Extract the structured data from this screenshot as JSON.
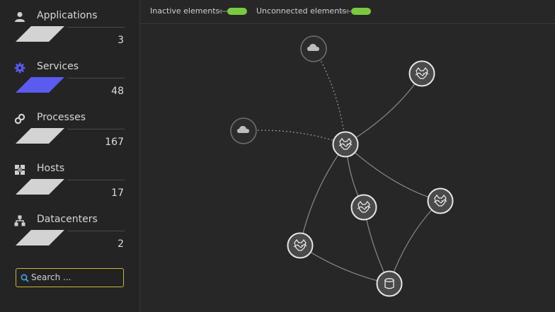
{
  "sidebar": {
    "layers": [
      {
        "label": "Applications",
        "count": "3",
        "icon": "user-icon",
        "active": false
      },
      {
        "label": "Services",
        "count": "48",
        "icon": "gear-icon",
        "active": true
      },
      {
        "label": "Processes",
        "count": "167",
        "icon": "link-icon",
        "active": false
      },
      {
        "label": "Hosts",
        "count": "17",
        "icon": "grid-icon",
        "active": false
      },
      {
        "label": "Datacenters",
        "count": "2",
        "icon": "hierarchy-icon",
        "active": false
      }
    ],
    "search": {
      "placeholder": "Search ..."
    }
  },
  "topbar": {
    "inactive_label": "Inactive elements:",
    "unconnected_label": "Unconnected elements:",
    "inactive_on": true,
    "unconnected_on": true
  },
  "graph": {
    "nodes": [
      {
        "id": "cloud-1",
        "type": "cloud",
        "inactive": true
      },
      {
        "id": "cloud-2",
        "type": "cloud",
        "inactive": true
      },
      {
        "id": "service-top-right",
        "type": "tomcat"
      },
      {
        "id": "service-center",
        "type": "tomcat"
      },
      {
        "id": "service-middle",
        "type": "tomcat"
      },
      {
        "id": "service-right",
        "type": "tomcat"
      },
      {
        "id": "service-bottom-left",
        "type": "tomcat"
      },
      {
        "id": "database",
        "type": "database"
      }
    ],
    "edges": [
      {
        "from": "cloud-1",
        "to": "service-center",
        "style": "dotted"
      },
      {
        "from": "cloud-2",
        "to": "service-center",
        "style": "dotted"
      },
      {
        "from": "service-center",
        "to": "service-top-right",
        "style": "solid"
      },
      {
        "from": "service-center",
        "to": "service-middle",
        "style": "solid"
      },
      {
        "from": "service-center",
        "to": "service-right",
        "style": "solid"
      },
      {
        "from": "service-center",
        "to": "service-bottom-left",
        "style": "solid"
      },
      {
        "from": "service-middle",
        "to": "database",
        "style": "solid"
      },
      {
        "from": "service-right",
        "to": "database",
        "style": "solid"
      },
      {
        "from": "service-bottom-left",
        "to": "database",
        "style": "solid"
      }
    ]
  },
  "colors": {
    "accent": "#5b5bf0",
    "toggle_on": "#7ac943",
    "search_border": "#c9b93a",
    "node_fill": "#4a4a4a",
    "node_stroke": "#e6e6e6"
  }
}
